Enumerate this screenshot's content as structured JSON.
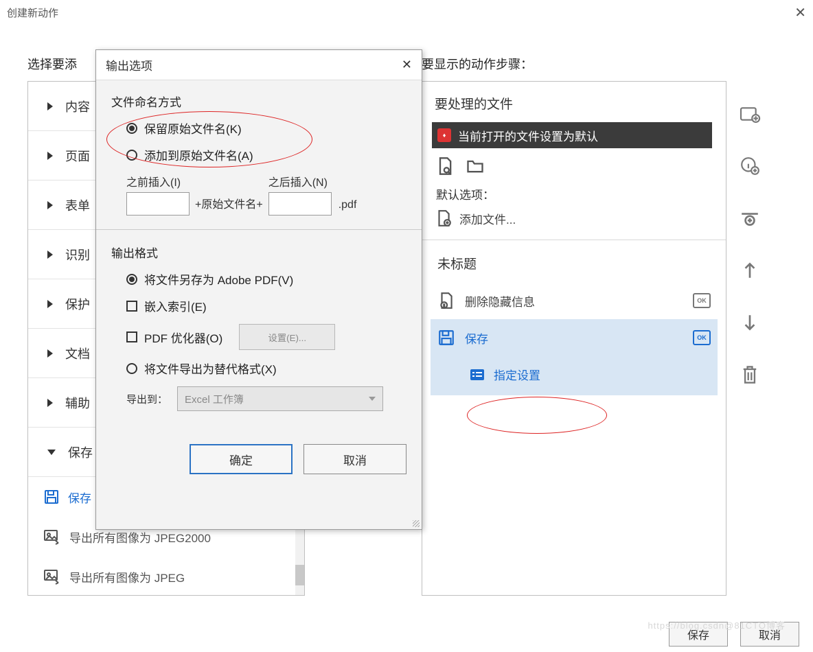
{
  "titlebar": {
    "title": "创建新动作"
  },
  "labels": {
    "left_section": "选择要添",
    "right_section": "要显示的动作步骤："
  },
  "accordion": {
    "items": [
      {
        "label": "内容"
      },
      {
        "label": "页面"
      },
      {
        "label": "表单"
      },
      {
        "label": "识别"
      },
      {
        "label": "保护"
      },
      {
        "label": "文档"
      },
      {
        "label": "辅助"
      }
    ],
    "save_group": {
      "label": "保存"
    },
    "sub": {
      "save": "保存",
      "export_jpeg2000": "导出所有图像为 JPEG2000",
      "export_jpeg": "导出所有图像为 JPEG"
    }
  },
  "right": {
    "heading": "要处理的文件",
    "default_row": "当前打开的文件设置为默认",
    "default_options": "默认选项：",
    "add_files": "添加文件...",
    "untitled": "未标题",
    "step_delete": "删除隐藏信息",
    "step_save": "保存",
    "specify_settings": "指定设置"
  },
  "dialog": {
    "title": "输出选项",
    "naming_section": "文件命名方式",
    "radio_keep": "保留原始文件名(K)",
    "radio_append": "添加到原始文件名(A)",
    "before_label": "之前插入(I)",
    "after_label": "之后插入(N)",
    "middle": "+原始文件名+",
    "ext": ".pdf",
    "format_section": "输出格式",
    "radio_saveas": "将文件另存为 Adobe PDF(V)",
    "chk_embed": "嵌入索引(E)",
    "chk_optimizer": "PDF 优化器(O)",
    "settings_btn": "设置(E)...",
    "radio_export": "将文件导出为替代格式(X)",
    "export_to": "导出到：",
    "export_select": "Excel 工作簿",
    "ok": "确定",
    "cancel": "取消"
  },
  "bottom": {
    "save": "保存",
    "cancel": "取消"
  },
  "watermark": "https://blog.csdn@81CTO博客"
}
